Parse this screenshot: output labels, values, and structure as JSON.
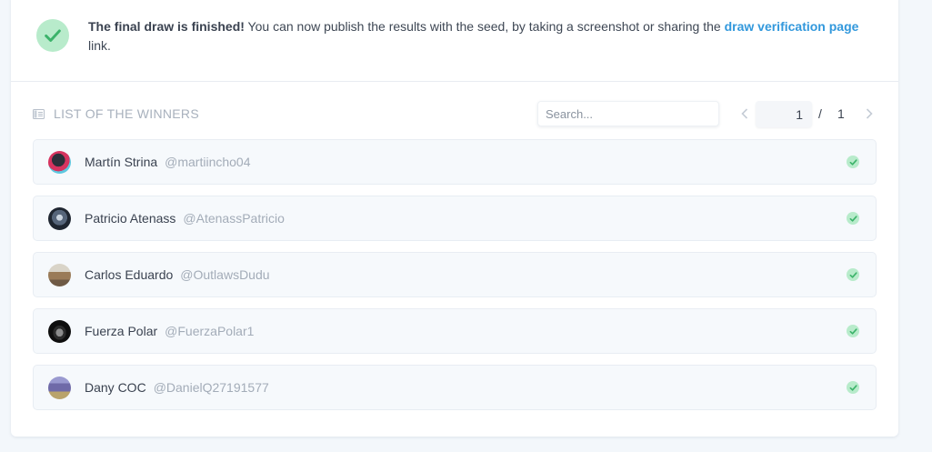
{
  "notice": {
    "bold_text": "The final draw is finished!",
    "text": " You can now publish the results with the seed, by taking a screenshot or sharing the ",
    "link_text": "draw verification page",
    "text_after": " link.",
    "icon": "check-icon",
    "accent_color": "#3bb36a"
  },
  "list": {
    "title": "LIST OF THE WINNERS",
    "icon": "list-icon",
    "search_placeholder": "Search...",
    "pagination": {
      "current_page": "1",
      "separator": "/",
      "total_pages": "1"
    }
  },
  "winners": [
    {
      "name": "Martín Strina",
      "handle": "@martiincho04",
      "avatar_color": "#d6335f"
    },
    {
      "name": "Patricio Atenass",
      "handle": "@AtenassPatricio",
      "avatar_color": "#3d4a5c"
    },
    {
      "name": "Carlos Eduardo",
      "handle": "@OutlawsDudu",
      "avatar_color": "#b89c79"
    },
    {
      "name": "Fuerza Polar",
      "handle": "@FuerzaPolar1",
      "avatar_color": "#111111"
    },
    {
      "name": "Dany COC",
      "handle": "@DanielQ27191577",
      "avatar_color": "#6f6aa8"
    }
  ]
}
